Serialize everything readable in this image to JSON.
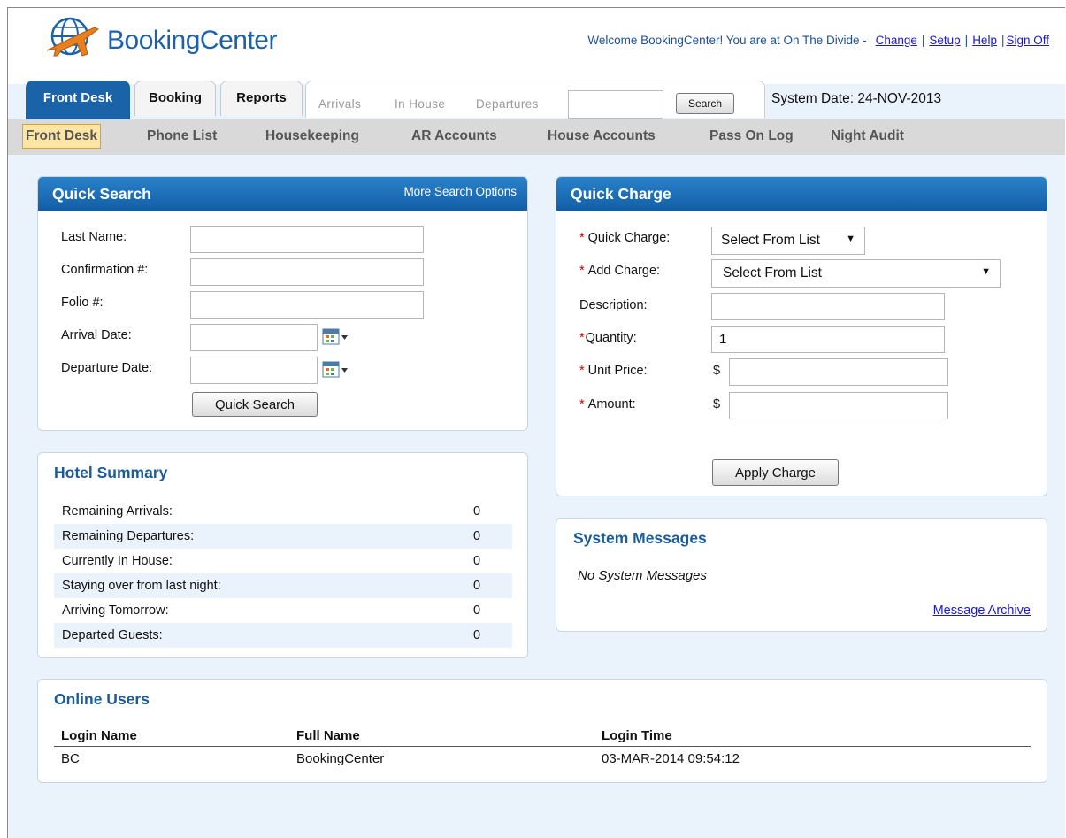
{
  "header": {
    "brand": "BookingCenter",
    "welcome_text": "Welcome BookingCenter! You are at On The Divide -",
    "links": [
      "Change",
      "Setup",
      "Help",
      "Sign Off"
    ]
  },
  "tabs": [
    {
      "label": "Front Desk",
      "active": true
    },
    {
      "label": "Booking",
      "active": false
    },
    {
      "label": "Reports",
      "active": false
    }
  ],
  "quick_links": [
    "Arrivals",
    "In House",
    "Departures"
  ],
  "search": {
    "value": "",
    "button": "Search"
  },
  "system_date": "System Date: 24-NOV-2013",
  "submenu": [
    "Front Desk",
    "Phone List",
    "Housekeeping",
    "AR Accounts",
    "House Accounts",
    "Pass On Log",
    "Night Audit"
  ],
  "quick_search": {
    "title": "Quick Search",
    "more": "More Search Options",
    "fields": {
      "last_name": "Last Name:",
      "confirmation": "Confirmation #:",
      "folio": "Folio #:",
      "arrival": "Arrival Date:",
      "departure": "Departure Date:"
    },
    "button": "Quick Search"
  },
  "quick_charge": {
    "title": "Quick Charge",
    "labels": {
      "quick_charge": "Quick Charge:",
      "add_charge": "Add Charge:",
      "description": "Description:",
      "quantity": "Quantity:",
      "unit_price": "Unit Price:",
      "amount": "Amount:"
    },
    "quick_charge_value": "Select From List",
    "add_charge_value": "Select From List",
    "quantity_value": "1",
    "currency": "$",
    "required_mark": "*",
    "button": "Apply Charge"
  },
  "hotel_summary": {
    "title": "Hotel Summary",
    "rows": [
      {
        "label": "Remaining Arrivals:",
        "value": "0"
      },
      {
        "label": "Remaining Departures:",
        "value": "0"
      },
      {
        "label": "Currently In House:",
        "value": "0"
      },
      {
        "label": "Staying over from last night:",
        "value": "0"
      },
      {
        "label": "Arriving Tomorrow:",
        "value": "0"
      },
      {
        "label": "Departed Guests:",
        "value": "0"
      }
    ]
  },
  "system_messages": {
    "title": "System Messages",
    "text": "No System Messages",
    "archive": "Message Archive"
  },
  "online_users": {
    "title": "Online Users",
    "columns": [
      "Login Name",
      "Full Name",
      "Login Time"
    ],
    "rows": [
      [
        "BC",
        "BookingCenter",
        "03-MAR-2014 09:54:12"
      ]
    ]
  },
  "colors": {
    "brand": "#1b62ab",
    "tab_active": "#1a63a8",
    "panel_header": "#1a6ab3",
    "page_bg": "#eaf2fb",
    "highlight": "#fde6a3"
  },
  "icons": [
    "globe-plane-logo-icon",
    "calendar-icon",
    "chevron-down-icon"
  ]
}
